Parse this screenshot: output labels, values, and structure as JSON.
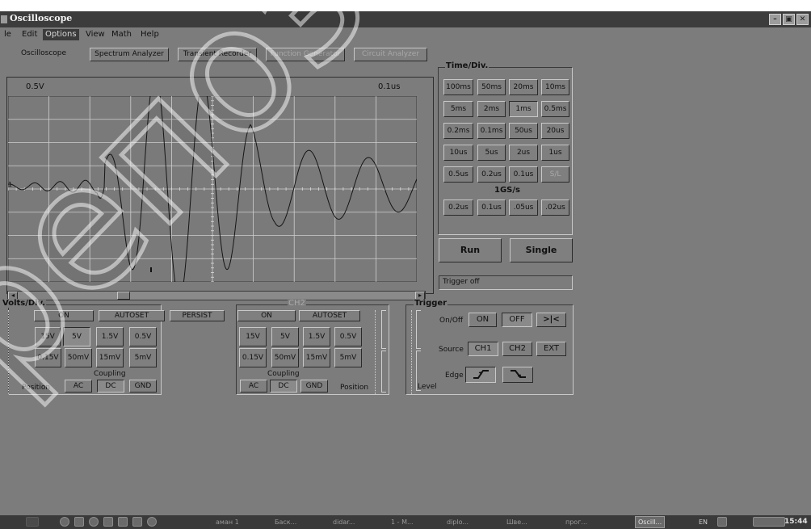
{
  "window": {
    "title": "Oscilloscope",
    "controls": [
      "–",
      "▣",
      "✕"
    ]
  },
  "menu": [
    "le",
    "Edit",
    "Options",
    "View",
    "Math",
    "Help"
  ],
  "tabs": [
    {
      "label": "Oscilloscope",
      "state": "active"
    },
    {
      "label": "Spectrum Analyzer",
      "state": "normal"
    },
    {
      "label": "Transient Recorder",
      "state": "normal"
    },
    {
      "label": "Function Generator",
      "state": "disabled"
    },
    {
      "label": "Circuit Analyzer",
      "state": "disabled"
    }
  ],
  "display": {
    "volts_label": "0.5V",
    "time_label": "0.1us",
    "ch1_marker": "1",
    "scroll_left": "◂",
    "scroll_right": "▸"
  },
  "time_div": {
    "title": "Time/Div.",
    "rows": [
      [
        "100ms",
        "50ms",
        "20ms",
        "10ms"
      ],
      [
        "5ms",
        "2ms",
        "1ms",
        "0.5ms"
      ],
      [
        "0.2ms",
        "0.1ms",
        "50us",
        "20us"
      ],
      [
        "10us",
        "5us",
        "2us",
        "1us"
      ],
      [
        "0.5us",
        "0.2us",
        "0.1us",
        "S/L"
      ]
    ],
    "selected": "1ms",
    "sample_rate": "1GS/s",
    "fast_row": [
      "0.2us",
      "0.1us",
      ".05us",
      ".02us"
    ]
  },
  "run_label": "Run",
  "single_label": "Single",
  "trigger_status": "Trigger off",
  "ch1": {
    "title": "Volts/Div.",
    "on": "ON",
    "autoset": "AUTOSET",
    "persist": "PERSIST",
    "row1": [
      "15V",
      "5V",
      "1.5V",
      "0.5V"
    ],
    "row2": [
      "0.15V",
      "50mV",
      "15mV",
      "5mV"
    ],
    "selected_volts": "5V",
    "coupling_label": "Coupling",
    "position_label": "Position",
    "coupling": [
      "AC",
      "DC",
      "GND"
    ],
    "selected_coupling": "DC"
  },
  "ch2": {
    "title": "CH2",
    "on": "ON",
    "autoset": "AUTOSET",
    "row1": [
      "15V",
      "5V",
      "1.5V",
      "0.5V"
    ],
    "row2": [
      "0.15V",
      "50mV",
      "15mV",
      "5mV"
    ],
    "coupling_label": "Coupling",
    "position_label": "Position",
    "coupling": [
      "AC",
      "DC",
      "GND"
    ],
    "selected_coupling": "DC"
  },
  "trigger": {
    "title": "Trigger",
    "onoff_label": "On/Off",
    "on": "ON",
    "off": "OFF",
    "center": ">|<",
    "source_label": "Source",
    "sources": [
      "CH1",
      "CH2",
      "EXT"
    ],
    "edge_label": "Edge",
    "level_label": "Level"
  },
  "taskbar": {
    "items": [
      "аман 1",
      "Баск...",
      "didar...",
      "1 - M...",
      "diplo...",
      "Шве...",
      "прог...",
      "Oscill..."
    ],
    "active_item": "Oscill...",
    "lang": "EN",
    "clock": "15:44"
  },
  "watermark": "репозиторий"
}
